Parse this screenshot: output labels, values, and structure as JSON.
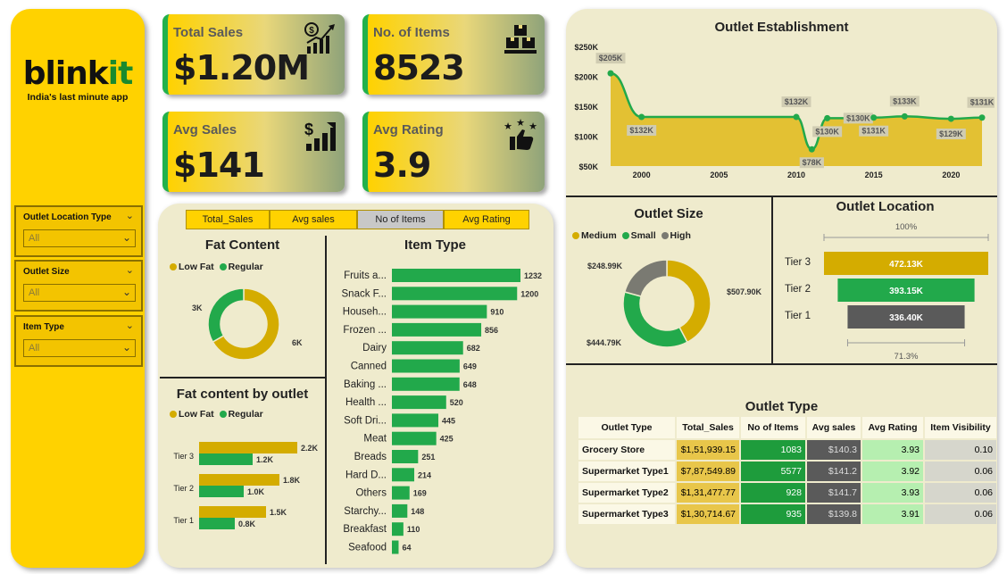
{
  "brand": {
    "logo_main": "blink",
    "logo_accent": "it",
    "tagline": "India's last minute app"
  },
  "slicers": [
    {
      "label": "Outlet Location Type",
      "value": "All"
    },
    {
      "label": "Outlet Size",
      "value": "All"
    },
    {
      "label": "Item Type",
      "value": "All"
    }
  ],
  "kpis": {
    "total_sales": {
      "label": "Total Sales",
      "value": "$1.20M",
      "icon": "sales-growth-icon"
    },
    "items": {
      "label": "No. of Items",
      "value": "8523",
      "icon": "boxes-icon"
    },
    "avg_sales": {
      "label": "Avg Sales",
      "value": "$141",
      "icon": "dollar-bars-icon"
    },
    "avg_rating": {
      "label": "Avg Rating",
      "value": "3.9",
      "icon": "stars-thumbs-up-icon"
    }
  },
  "metric_tabs": [
    "Total_Sales",
    "Avg sales",
    "No of Items",
    "Avg Rating"
  ],
  "metric_tabs_active": 2,
  "colors": {
    "yellow": "#ffd200",
    "gold": "#d4ac00",
    "green": "#22a94b",
    "grey": "#7a7a72"
  },
  "fat_content": {
    "title": "Fat Content",
    "legend": [
      "Low Fat",
      "Regular"
    ],
    "chart_data": {
      "type": "pie",
      "labels": [
        "Low Fat",
        "Regular"
      ],
      "values": [
        6,
        3
      ],
      "data_labels": [
        "6K",
        "3K"
      ]
    }
  },
  "fat_by_outlet": {
    "title": "Fat content by outlet",
    "legend": [
      "Low Fat",
      "Regular"
    ],
    "chart_data": {
      "type": "bar",
      "categories": [
        "Tier 3",
        "Tier 2",
        "Tier 1"
      ],
      "series": [
        {
          "name": "Low Fat",
          "values": [
            2.2,
            1.8,
            1.5
          ],
          "labels": [
            "2.2K",
            "1.8K",
            "1.5K"
          ]
        },
        {
          "name": "Regular",
          "values": [
            1.2,
            1.0,
            0.8
          ],
          "labels": [
            "1.2K",
            "1.0K",
            "0.8K"
          ]
        }
      ]
    }
  },
  "item_type": {
    "title": "Item Type",
    "chart_data": {
      "type": "bar",
      "categories": [
        "Fruits a...",
        "Snack F...",
        "Househ...",
        "Frozen ...",
        "Dairy",
        "Canned",
        "Baking ...",
        "Health ...",
        "Soft Dri...",
        "Meat",
        "Breads",
        "Hard D...",
        "Others",
        "Starchy...",
        "Breakfast",
        "Seafood"
      ],
      "values": [
        1232,
        1200,
        910,
        856,
        682,
        649,
        648,
        520,
        445,
        425,
        251,
        214,
        169,
        148,
        110,
        64
      ]
    }
  },
  "outlet_establishment": {
    "title": "Outlet Establishment",
    "chart_data": {
      "type": "area",
      "x": [
        1998,
        2000,
        2010,
        2011,
        2012,
        2014,
        2015,
        2017,
        2020,
        2022
      ],
      "values": [
        205,
        132,
        132,
        78,
        130,
        130,
        131,
        133,
        129,
        131
      ],
      "data_labels": [
        "$205K",
        "$132K",
        "$132K",
        "$78K",
        "$130K",
        "$130K",
        "$131K",
        "$133K",
        "$129K",
        "$131K"
      ],
      "yticks": [
        "$250K",
        "$200K",
        "$150K",
        "$100K",
        "$50K"
      ],
      "ytick_values": [
        250,
        200,
        150,
        100,
        50
      ],
      "xticks": [
        "2000",
        "2005",
        "2010",
        "2015",
        "2020"
      ],
      "xtick_values": [
        2000,
        2005,
        2010,
        2015,
        2020
      ],
      "xlim": [
        1998,
        2022
      ],
      "ylim": [
        50,
        250
      ]
    }
  },
  "outlet_size": {
    "title": "Outlet Size",
    "legend": [
      "Medium",
      "Small",
      "High"
    ],
    "chart_data": {
      "type": "pie",
      "labels": [
        "Medium",
        "Small",
        "High"
      ],
      "values": [
        507.9,
        444.79,
        248.99
      ],
      "data_labels": [
        "$507.90K",
        "$444.79K",
        "$248.99K"
      ]
    }
  },
  "outlet_location": {
    "title": "Outlet Location",
    "top_pct": "100%",
    "bottom_pct": "71.3%",
    "chart_data": {
      "type": "bar",
      "categories": [
        "Tier 3",
        "Tier 2",
        "Tier 1"
      ],
      "values": [
        472.13,
        393.15,
        336.4
      ],
      "data_labels": [
        "472.13K",
        "393.15K",
        "336.40K"
      ]
    }
  },
  "outlet_type": {
    "title": "Outlet Type",
    "columns": [
      "Outlet Type",
      "Total_Sales",
      "No of Items",
      "Avg sales",
      "Avg Rating",
      "Item Visibility"
    ],
    "rows": [
      [
        "Grocery Store",
        "$1,51,939.15",
        "1083",
        "$140.3",
        "3.93",
        "0.10"
      ],
      [
        "Supermarket Type1",
        "$7,87,549.89",
        "5577",
        "$141.2",
        "3.92",
        "0.06"
      ],
      [
        "Supermarket Type2",
        "$1,31,477.77",
        "928",
        "$141.7",
        "3.93",
        "0.06"
      ],
      [
        "Supermarket Type3",
        "$1,30,714.67",
        "935",
        "$139.8",
        "3.91",
        "0.06"
      ]
    ]
  }
}
